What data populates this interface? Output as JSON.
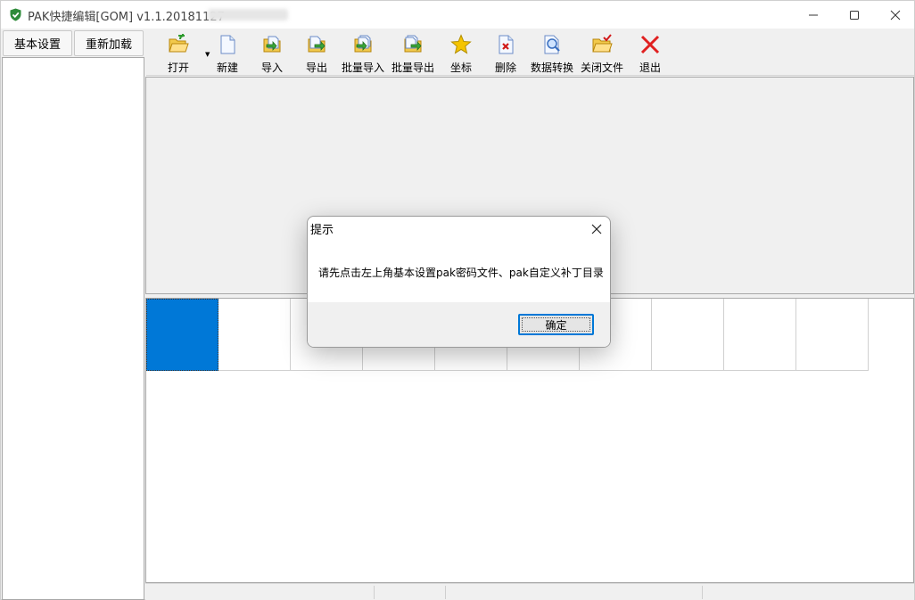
{
  "window": {
    "title": "PAK快捷编辑[GOM] v1.1.20181127",
    "controls": {
      "minimize": "minimize-icon",
      "maximize": "maximize-icon",
      "close": "close-icon"
    }
  },
  "left_panel": {
    "basic_settings": "基本设置",
    "reload": "重新加载"
  },
  "toolbar": {
    "items": [
      {
        "label": "打开",
        "icon": "open-folder-icon"
      },
      {
        "label": "新建",
        "icon": "new-file-icon"
      },
      {
        "label": "导入",
        "icon": "import-icon"
      },
      {
        "label": "导出",
        "icon": "export-icon"
      },
      {
        "label": "批量导入",
        "icon": "batch-import-icon"
      },
      {
        "label": "批量导出",
        "icon": "batch-export-icon"
      },
      {
        "label": "坐标",
        "icon": "star-icon"
      },
      {
        "label": "删除",
        "icon": "delete-file-icon"
      },
      {
        "label": "数据转换",
        "icon": "data-convert-icon"
      },
      {
        "label": "关闭文件",
        "icon": "close-file-icon"
      },
      {
        "label": "退出",
        "icon": "exit-icon"
      }
    ]
  },
  "grid": {
    "cell_count": 10,
    "selected_index": 0
  },
  "dialog": {
    "title": "提示",
    "message": "请先点击左上角基本设置pak密码文件、pak自定义补丁目录",
    "ok_label": "确定"
  },
  "colors": {
    "accent": "#0078d7",
    "app_icon": "#2e8b3a",
    "exit_red": "#e02020",
    "star_yellow": "#f5c400"
  }
}
